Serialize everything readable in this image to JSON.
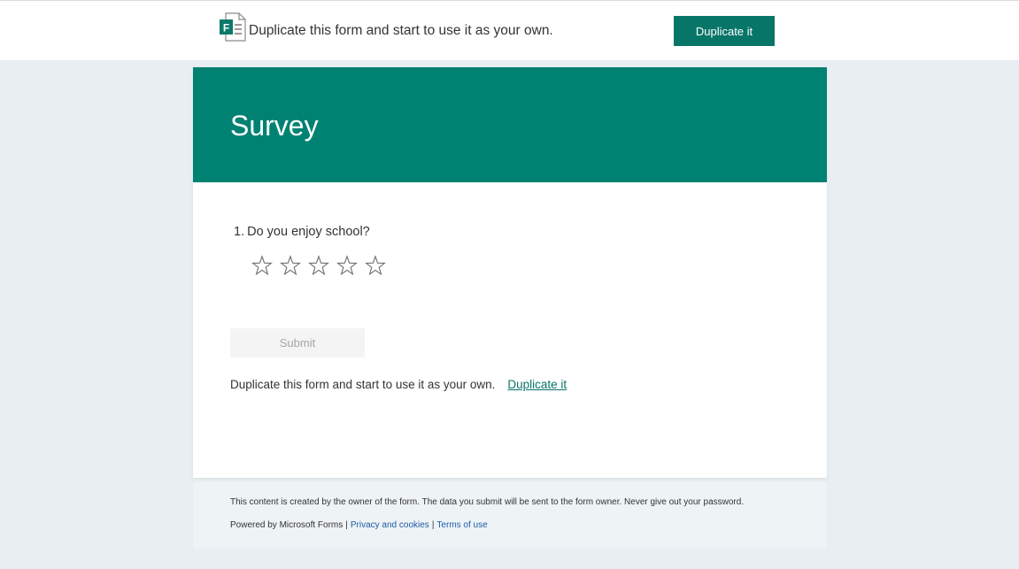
{
  "top_banner": {
    "text": "Duplicate this form and start to use it as your own.",
    "button_label": "Duplicate it",
    "logo_icon": "microsoft-forms-logo-icon"
  },
  "form": {
    "title": "Survey",
    "header_color": "#008272",
    "questions": [
      {
        "number": "1.",
        "text": "Do you enjoy school?",
        "type": "rating",
        "max_stars": 5,
        "selected": 0
      }
    ],
    "submit_label": "Submit",
    "duplicate_text": "Duplicate this form and start to use it as your own.",
    "duplicate_link": "Duplicate it"
  },
  "footer": {
    "notice": "This content is created by the owner of the form. The data you submit will be sent to the form owner. Never give out your password.",
    "powered_by": "Powered by Microsoft Forms",
    "separator": "|",
    "privacy_link": "Privacy and cookies",
    "terms_link": "Terms of use"
  },
  "colors": {
    "accent": "#077568",
    "page_background": "#e8eef1",
    "link": "#1e5aa8"
  }
}
